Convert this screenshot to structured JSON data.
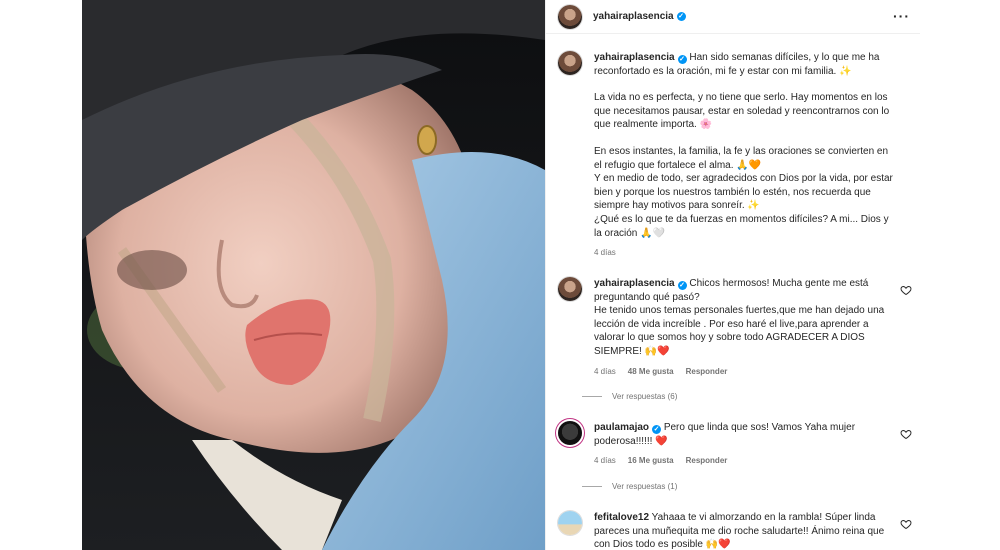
{
  "post": {
    "username": "yahairaplasencia",
    "more_icon": "more-horizontal-icon"
  },
  "caption": {
    "username": "yahairaplasencia",
    "p1": "Han sido semanas difíciles, y lo que me ha reconfortado es la oración, mi fe y estar con mi familia. ✨",
    "p2": "La vida no es perfecta, y no tiene que serlo. Hay momentos en los que necesitamos pausar, estar en soledad y reencontrarnos con lo que realmente importa. 🌸",
    "p3a": "En esos instantes, la familia, la fe y las oraciones se convierten en el refugio que fortalece el alma. 🙏🧡",
    "p3b": "Y en medio de todo, ser agradecidos con Dios por la vida, por estar bien y porque los nuestros también lo estén, nos recuerda que siempre hay motivos para sonreír. ✨",
    "p3c": "¿Qué es lo que te da fuerzas en momentos difíciles? A mi... Dios y la oración 🙏🤍",
    "time": "4 días"
  },
  "comments": [
    {
      "username": "yahairaplasencia",
      "lines": [
        "Chicos hermosos! Mucha gente me está preguntando qué pasó?",
        "He tenido unos temas personales fuertes,que me han dejado una lección de vida increíble . Por eso haré el live,para aprender a valorar lo que somos hoy y sobre todo AGRADECER A DIOS SIEMPRE! 🙌❤️"
      ],
      "time": "4 días",
      "likes": "48 Me gusta",
      "reply": "Responder",
      "view_replies": "Ver respuestas (6)"
    },
    {
      "username": "paulamajao",
      "lines": [
        "Pero que linda que sos! Vamos Yaha mujer poderosa!!!!!! ❤️"
      ],
      "time": "4 días",
      "likes": "16 Me gusta",
      "reply": "Responder",
      "view_replies": "Ver respuestas (1)"
    },
    {
      "username": "fefitalove12",
      "lines": [
        "Yahaaa te vi almorzando en la rambla! Súper linda pareces una muñequita me dio roche saludarte!! Ánimo reina que con Dios todo es posible 🙌❤️"
      ]
    }
  ],
  "colors": {
    "verified": "#0095f6",
    "meta": "#737373",
    "text": "#262626"
  }
}
